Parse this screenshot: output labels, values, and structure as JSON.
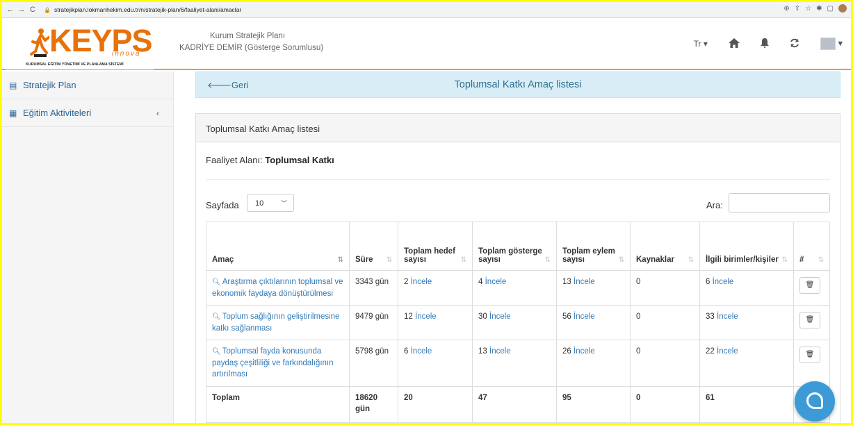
{
  "browser": {
    "url": "stratejikplan.lokmanhekim.edu.tr/n/stratejik-plan/6/faaliyet-alani/amaclar"
  },
  "header": {
    "logo_text": "KEYPS",
    "logo_sub": "innova",
    "logo_caption": "KURUMSAL EĞİTİM YÖNETİMİ VE PLANLAMA SİSTEMİ",
    "plan_title": "Kurum Stratejik Planı",
    "user_name": "KADRİYE DEMİR (Gösterge Sorumlusu)",
    "language": "Tr"
  },
  "sidebar": {
    "items": [
      {
        "label": "Stratejik Plan",
        "icon": "table-icon"
      },
      {
        "label": "Eğitim Aktiviteleri",
        "icon": "grid-icon"
      }
    ]
  },
  "topbar": {
    "back_label": "Geri",
    "title": "Toplumsal Katkı Amaç listesi"
  },
  "panel": {
    "heading": "Toplumsal Katkı Amaç listesi",
    "faaliyet_label": "Faaliyet Alanı:",
    "faaliyet_value": "Toplumsal Katkı",
    "length_label": "Sayfada",
    "length_value": "10",
    "search_label": "Ara:",
    "search_value": ""
  },
  "table": {
    "columns": [
      "Amaç",
      "Süre",
      "Toplam hedef sayısı",
      "Toplam gösterge sayısı",
      "Toplam eylem sayısı",
      "Kaynaklar",
      "İlgili birimler/kişiler",
      "#"
    ],
    "link_label": "İncele",
    "rows": [
      {
        "amac": "Araştırma çıktılarının toplumsal ve ekonomik faydaya dönüştürülmesi",
        "sure": "3343 gün",
        "hedef": "2",
        "gosterge": "4",
        "eylem": "13",
        "kaynak": "0",
        "birim": "6"
      },
      {
        "amac": "Toplum sağlığının geliştirilmesine katkı sağlanması",
        "sure": "9479 gün",
        "hedef": "12",
        "gosterge": "30",
        "eylem": "56",
        "kaynak": "0",
        "birim": "33"
      },
      {
        "amac": "Toplumsal fayda konusunda paydaş çeşitliliği ve farkındalığının artırılması",
        "sure": "5798 gün",
        "hedef": "6",
        "gosterge": "13",
        "eylem": "26",
        "kaynak": "0",
        "birim": "22"
      }
    ],
    "total": {
      "label": "Toplam",
      "sure": "18620 gün",
      "hedef": "20",
      "gosterge": "47",
      "eylem": "95",
      "kaynak": "0",
      "birim": "61",
      "hash": "#"
    }
  },
  "colors": {
    "accent": "#f39c12",
    "link": "#337ab7",
    "info_bg": "#d9edf7",
    "logo": "#e8710a",
    "chat": "#3c9bd6"
  }
}
